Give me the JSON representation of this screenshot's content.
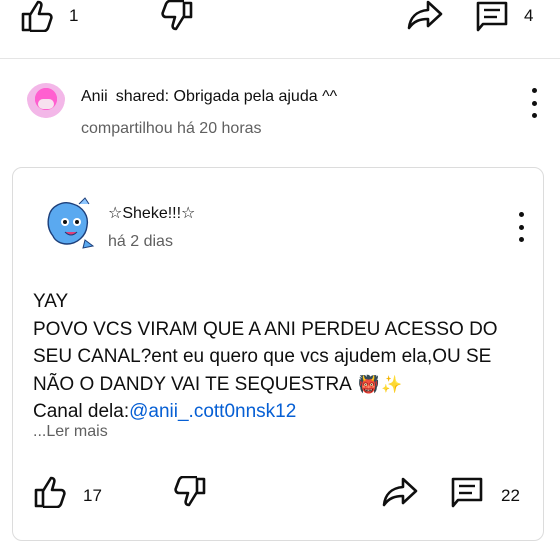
{
  "top_actions": {
    "likes": "1",
    "comments": "4"
  },
  "shared_post": {
    "author": "Anii",
    "verb": "shared:",
    "message": "Obrigada pela ajuda ^^",
    "subtitle": "compartilhou há 20 horas"
  },
  "original_post": {
    "author": "☆Sheke!!!☆",
    "time": "há 2 dias",
    "lines": [
      "YAY",
      "POVO VCS VIRAM QUE A ANI PERDEU ACESSO DO",
      "SEU CANAL?ent eu quero que vcs ajudem ela,OU SE",
      "NÃO O DANDY VAI TE SEQUESTRA"
    ],
    "emoji_1": "👹",
    "emoji_2": "✨",
    "channel_label": "Canal dela:",
    "channel_link": "@anii_.cott0nnsk12",
    "read_more": "...Ler mais",
    "likes": "17",
    "comments": "22"
  },
  "icons": [
    "like-icon",
    "dislike-icon",
    "share-icon",
    "comment-icon",
    "more-vert-icon"
  ]
}
